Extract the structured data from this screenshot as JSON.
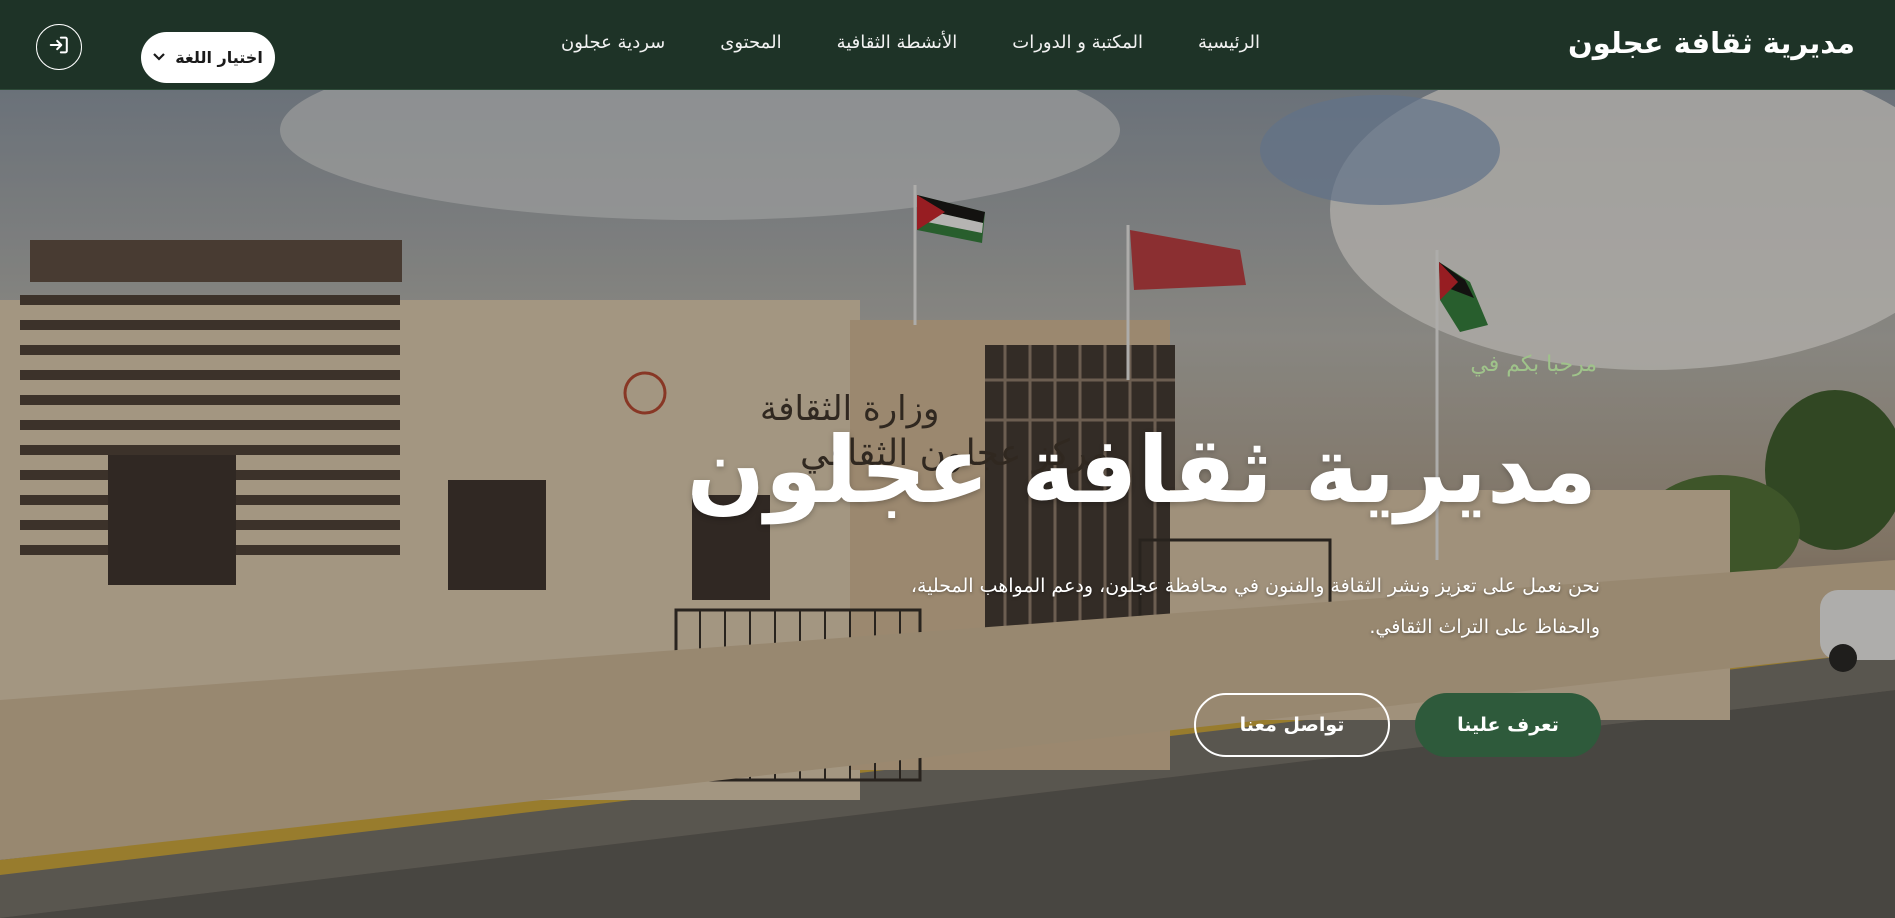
{
  "navbar": {
    "brand": "مديرية ثقافة عجلون",
    "links": [
      "الرئيسية",
      "المكتبة و الدورات",
      "الأنشطة الثقافية",
      "المحتوى",
      "سردية عجلون"
    ],
    "language_select": {
      "selected": "اختيار اللغة"
    },
    "login_icon": "login-icon",
    "background_color": "#1e3327"
  },
  "hero": {
    "welcome": "مرحبا بكم في",
    "title": "مديرية ثقافة عجلون",
    "description": "نحن نعمل على تعزيز ونشر الثقافة والفنون في محافظة عجلون، ودعم المواهب المحلية، والحفاظ على التراث الثقافي.",
    "primary_button": "تعرف علينا",
    "secondary_button": "تواصل معنا",
    "sign_text": [
      "وزارة الثقافة",
      "مركز عجلون الثقافي"
    ],
    "accent_color": "#2e5a3b",
    "welcome_color": "#9fc38a"
  }
}
